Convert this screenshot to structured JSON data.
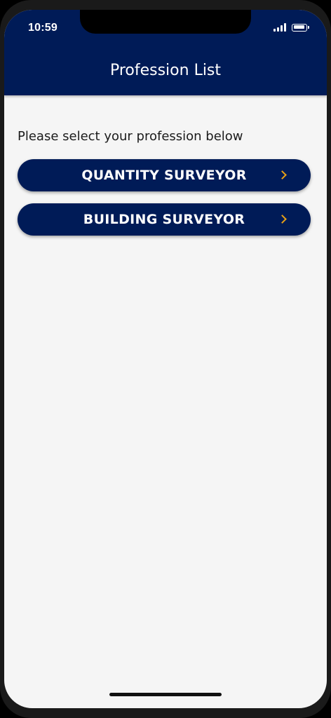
{
  "status_bar": {
    "time": "10:59",
    "signal_icon": "cellular-signal-icon",
    "battery_icon": "battery-icon"
  },
  "header": {
    "title": "Profession List",
    "background_color": "#001b57"
  },
  "main": {
    "prompt": "Please select your profession below",
    "professions": [
      {
        "label": "QUANTITY SURVEYOR",
        "icon": "chevron-right-icon"
      },
      {
        "label": "BUILDING SURVEYOR",
        "icon": "chevron-right-icon"
      }
    ],
    "button_color": "#001b57",
    "chevron_color": "#e8a216"
  }
}
